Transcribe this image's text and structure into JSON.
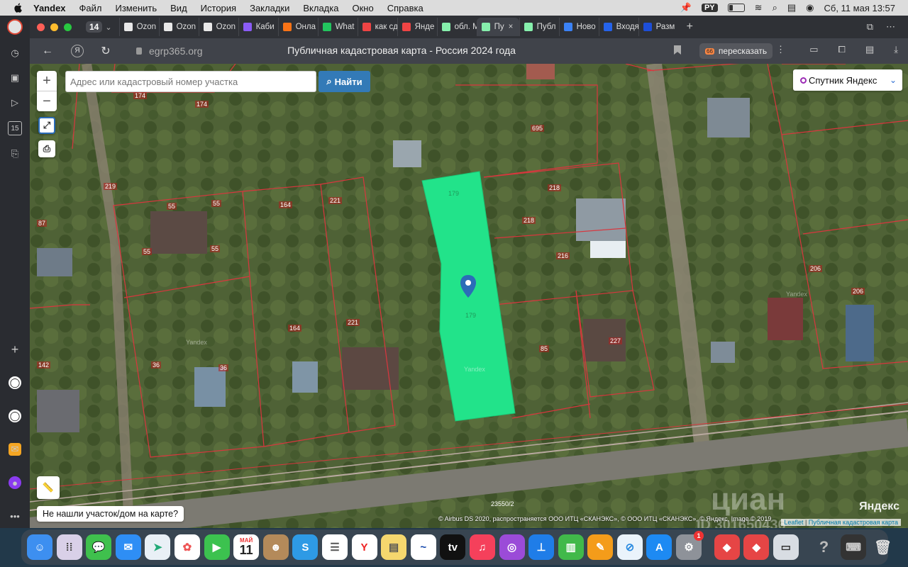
{
  "menubar": {
    "app": "Yandex",
    "items": [
      "Файл",
      "Изменить",
      "Вид",
      "История",
      "Закладки",
      "Вкладка",
      "Окно",
      "Справка"
    ],
    "input_source": "PY",
    "clock": "Сб, 11 мая  13:57"
  },
  "browser": {
    "tab_count": "14",
    "tabs": [
      {
        "label": "Ozon",
        "color": "#e8e8e8"
      },
      {
        "label": "Ozon",
        "color": "#e8e8e8"
      },
      {
        "label": "Ozon",
        "color": "#e8e8e8"
      },
      {
        "label": "Каби",
        "color": "#8b5cf6"
      },
      {
        "label": "Онла",
        "color": "#f97316"
      },
      {
        "label": "What",
        "color": "#22c55e"
      },
      {
        "label": "как сд",
        "color": "#ef4444"
      },
      {
        "label": "Янде",
        "color": "#ef4444"
      },
      {
        "label": "обл. М",
        "color": "#86efac"
      },
      {
        "label": "Пу",
        "color": "#86efac",
        "active": true
      },
      {
        "label": "Публ",
        "color": "#86efac"
      },
      {
        "label": "Ново",
        "color": "#3b82f6"
      },
      {
        "label": "Входя",
        "color": "#2563eb"
      },
      {
        "label": "Разм",
        "color": "#1d4ed8"
      }
    ],
    "url": "egrp365.org",
    "page_title": "Публичная кадастровая карта - Россия 2024 года",
    "retell_label": "пересказать",
    "retell_icon": "66"
  },
  "map": {
    "search_placeholder": "Адрес или кадастровый номер участка",
    "find_label": "Найти",
    "zoom_in": "+",
    "zoom_out": "−",
    "layer": "Спутник Яндекс",
    "not_found": "Не нашли участок/дом на карте?",
    "attribution": "© Airbus DS 2020, распространяется ООО ИТЦ «СКАНЭКС», © ООО ИТЦ «СКАНЭКС», © Яндекс, Image © 2019",
    "leaflet": "Leaflet",
    "source_link": "Публичная кадастровая карта",
    "yandex_logo": "Яндекс",
    "watermark": "циан",
    "watermark_id": "ID 301650436",
    "road_label": "23550/2",
    "plot_labels": {
      "p174a": "174",
      "p174b": "174",
      "p695": "695",
      "p218a": "218",
      "p218b": "218",
      "p216": "216",
      "p55a": "55",
      "p55b": "55",
      "p55c": "55",
      "p55d": "55",
      "p164a": "164",
      "p164b": "164",
      "p221a": "221",
      "p221b": "221",
      "p87": "87",
      "p219": "219",
      "p142": "142",
      "p36a": "36",
      "p36b": "36",
      "p85": "85",
      "p227": "227",
      "p206a": "206",
      "p206b": "206",
      "p179a": "179",
      "p179b": "179",
      "yandex_a": "Yandex",
      "yandex_b": "Yandex",
      "yandex_c": "Yandex"
    }
  },
  "dock": {
    "calendar_month": "МАЙ",
    "calendar_day": "11",
    "settings_badge": "1"
  },
  "colors": {
    "selected_parcel": "#22e38a",
    "parcel_border": "#d9363e",
    "marker": "#2b6cb8",
    "find_button": "#337ab7"
  }
}
